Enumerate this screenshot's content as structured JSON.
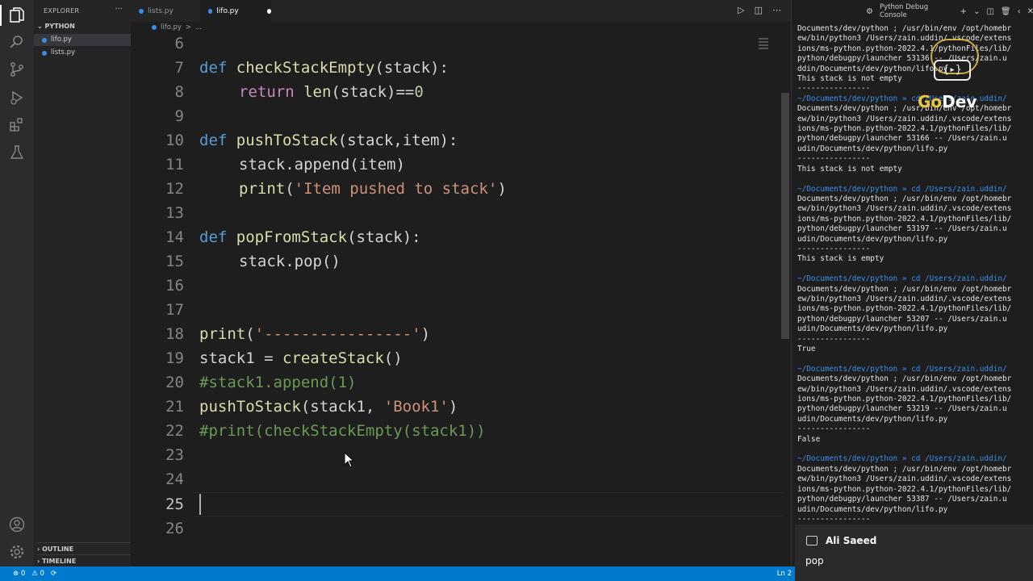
{
  "activity_bar": {
    "icons": [
      "files-icon",
      "search-icon",
      "source-control-icon",
      "run-debug-icon",
      "extensions-icon",
      "testing-icon"
    ],
    "bottom_icons": [
      "account-icon",
      "settings-gear-icon"
    ]
  },
  "sidebar": {
    "header": "EXPLORER",
    "more": "···",
    "folder": "PYTHON",
    "files": [
      {
        "name": "lifo.py",
        "selected": true
      },
      {
        "name": "lists.py",
        "selected": false
      }
    ],
    "outline": "OUTLINE",
    "timeline": "TIMELINE"
  },
  "tabs": [
    {
      "label": "lists.py",
      "active": false
    },
    {
      "label": "lifo.py",
      "active": true,
      "modified": true
    }
  ],
  "breadcrumb": {
    "file": "lifo.py",
    "sep": ">",
    "rest": "..."
  },
  "editor": {
    "current_line": 25,
    "lines": [
      {
        "n": "6"
      },
      {
        "n": "7"
      },
      {
        "n": "8"
      },
      {
        "n": "9"
      },
      {
        "n": "10"
      },
      {
        "n": "11"
      },
      {
        "n": "12"
      },
      {
        "n": "13"
      },
      {
        "n": "14"
      },
      {
        "n": "15"
      },
      {
        "n": "16"
      },
      {
        "n": "17"
      },
      {
        "n": "18"
      },
      {
        "n": "19"
      },
      {
        "n": "20"
      },
      {
        "n": "21"
      },
      {
        "n": "22"
      },
      {
        "n": "23"
      },
      {
        "n": "24"
      },
      {
        "n": "25"
      },
      {
        "n": "26"
      }
    ],
    "code": {
      "l7_def": "def",
      "l7_fn": "checkStackEmpty",
      "l7_rest": "(stack):",
      "l8_ret": "return",
      "l8_fn": "len",
      "l8_rest": "(stack)==",
      "l8_num": "0",
      "l10_def": "def",
      "l10_fn": "pushToStack",
      "l10_rest": "(stack,item):",
      "l11": "stack.append(item)",
      "l12_fn": "print",
      "l12_open": "(",
      "l12_str": "'Item pushed to stack'",
      "l12_close": ")",
      "l14_def": "def",
      "l14_fn": "popFromStack",
      "l14_rest": "(stack):",
      "l15": "stack.pop()",
      "l18_fn": "print",
      "l18_open": "(",
      "l18_str": "'----------------'",
      "l18_close": ")",
      "l19_a": "stack1 = ",
      "l19_fn": "createStack",
      "l19_b": "()",
      "l20": "#stack1.append(1)",
      "l21_fn": "pushToStack",
      "l21_a": "(stack1, ",
      "l21_str": "'Book1'",
      "l21_b": ")",
      "l22": "#print(checkStackEmpty(stack1))"
    }
  },
  "panel": {
    "title": "Python Debug Console",
    "terminal": [
      {
        "t": "Documents/dev/python ; /usr/bin/env /opt/homebr",
        "c": "out"
      },
      {
        "t": "ew/bin/python3 /Users/zain.uddin/.vscode/extens",
        "c": "out"
      },
      {
        "t": "ions/ms-python.python-2022.4.1/pythonFiles/lib/",
        "c": "out"
      },
      {
        "t": "python/debugpy/launcher 53136 -- /Users/zain.u",
        "c": "out"
      },
      {
        "t": "ddin/Documents/dev/python/lifo.py",
        "c": "out"
      },
      {
        "t": "This stack is not empty",
        "c": "out"
      },
      {
        "t": "----------------",
        "c": "out"
      },
      {
        "t": "~/Documents/dev/python » cd /Users/zain.uddin/",
        "c": "path"
      },
      {
        "t": "Documents/dev/python ; /usr/bin/env /opt/homebr",
        "c": "out"
      },
      {
        "t": "ew/bin/python3 /Users/zain.uddin/.vscode/extens",
        "c": "out"
      },
      {
        "t": "ions/ms-python.python-2022.4.1/pythonFiles/lib/",
        "c": "out"
      },
      {
        "t": "python/debugpy/launcher 53166 -- /Users/zain.u",
        "c": "out"
      },
      {
        "t": "udin/Documents/dev/python/lifo.py",
        "c": "out"
      },
      {
        "t": "----------------",
        "c": "out"
      },
      {
        "t": "This stack is not empty",
        "c": "out"
      },
      {
        "t": "",
        "c": "out"
      },
      {
        "t": "~/Documents/dev/python » cd /Users/zain.uddin/",
        "c": "path"
      },
      {
        "t": "Documents/dev/python ; /usr/bin/env /opt/homebr",
        "c": "out"
      },
      {
        "t": "ew/bin/python3 /Users/zain.uddin/.vscode/extens",
        "c": "out"
      },
      {
        "t": "ions/ms-python.python-2022.4.1/pythonFiles/lib/",
        "c": "out"
      },
      {
        "t": "python/debugpy/launcher 53197 -- /Users/zain.u",
        "c": "out"
      },
      {
        "t": "udin/Documents/dev/python/lifo.py",
        "c": "out"
      },
      {
        "t": "----------------",
        "c": "out"
      },
      {
        "t": "This stack is empty",
        "c": "out"
      },
      {
        "t": "",
        "c": "out"
      },
      {
        "t": "~/Documents/dev/python » cd /Users/zain.uddin/",
        "c": "path"
      },
      {
        "t": "Documents/dev/python ; /usr/bin/env /opt/homebr",
        "c": "out"
      },
      {
        "t": "ew/bin/python3 /Users/zain.uddin/.vscode/extens",
        "c": "out"
      },
      {
        "t": "ions/ms-python.python-2022.4.1/pythonFiles/lib/",
        "c": "out"
      },
      {
        "t": "python/debugpy/launcher 53207 -- /Users/zain.u",
        "c": "out"
      },
      {
        "t": "udin/Documents/dev/python/lifo.py",
        "c": "out"
      },
      {
        "t": "----------------",
        "c": "out"
      },
      {
        "t": "True",
        "c": "out"
      },
      {
        "t": "",
        "c": "out"
      },
      {
        "t": "~/Documents/dev/python » cd /Users/zain.uddin/",
        "c": "path"
      },
      {
        "t": "Documents/dev/python ; /usr/bin/env /opt/homebr",
        "c": "out"
      },
      {
        "t": "ew/bin/python3 /Users/zain.uddin/.vscode/extens",
        "c": "out"
      },
      {
        "t": "ions/ms-python.python-2022.4.1/pythonFiles/lib/",
        "c": "out"
      },
      {
        "t": "python/debugpy/launcher 53219 -- /Users/zain.u",
        "c": "out"
      },
      {
        "t": "udin/Documents/dev/python/lifo.py",
        "c": "out"
      },
      {
        "t": "----------------",
        "c": "out"
      },
      {
        "t": "False",
        "c": "out"
      },
      {
        "t": "",
        "c": "out"
      },
      {
        "t": "~/Documents/dev/python » cd /Users/zain.uddin/",
        "c": "path"
      },
      {
        "t": "Documents/dev/python ; /usr/bin/env /opt/homebr",
        "c": "out"
      },
      {
        "t": "ew/bin/python3 /Users/zain.uddin/.vscode/extens",
        "c": "out"
      },
      {
        "t": "ions/ms-python.python-2022.4.1/pythonFiles/lib/",
        "c": "out"
      },
      {
        "t": "python/debugpy/launcher 53387 -- /Users/zain.u",
        "c": "out"
      },
      {
        "t": "udin/Documents/dev/python/lifo.py",
        "c": "out"
      },
      {
        "t": "----------------",
        "c": "out"
      }
    ]
  },
  "watermark": {
    "brand_a": "Go",
    "brand_b": "Dev",
    "code_glyph": "{▸}"
  },
  "chat": {
    "name": "Ali Saeed",
    "message": "pop"
  },
  "status": {
    "errors": "⊗ 0",
    "warnings": "⚠ 0",
    "position": "Ln 2"
  },
  "colors": {
    "accent": "#007acc",
    "keyword": "#569cd6",
    "function": "#dcdcaa",
    "string": "#ce9178",
    "comment": "#6a9955",
    "number": "#b5cea8"
  }
}
